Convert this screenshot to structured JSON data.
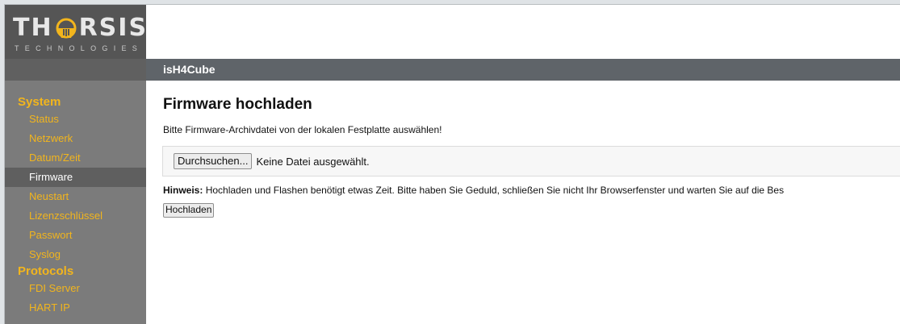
{
  "logo": {
    "part1": "TH",
    "part2": "RSIS",
    "subtitle": "TECHNOLOGIES"
  },
  "header": {
    "app_title": "isH4Cube"
  },
  "sidebar": {
    "sections": [
      {
        "label": "System",
        "items": [
          "Status",
          "Netzwerk",
          "Datum/Zeit",
          "Firmware",
          "Neustart",
          "Lizenzschlüssel",
          "Passwort",
          "Syslog"
        ]
      },
      {
        "label": "Protocols",
        "items": [
          "FDI Server",
          "HART IP"
        ]
      }
    ],
    "active_item": "Firmware"
  },
  "main": {
    "title": "Firmware hochladen",
    "description": "Bitte Firmware-Archivdatei von der lokalen Festplatte auswählen!",
    "browse_label": "Durchsuchen...",
    "file_status": "Keine Datei ausgewählt.",
    "hint_label": "Hinweis:",
    "hint_text": "Hochladen und Flashen benötigt etwas Zeit. Bitte haben Sie Geduld, schließen Sie nicht Ihr Browserfenster und warten Sie auf die Bes",
    "upload_label": "Hochladen"
  },
  "colors": {
    "accent": "#f2b51d",
    "sidebar_bg": "#7b7b7b",
    "header_bar": "#5f6469",
    "logo_bg": "#555555"
  }
}
